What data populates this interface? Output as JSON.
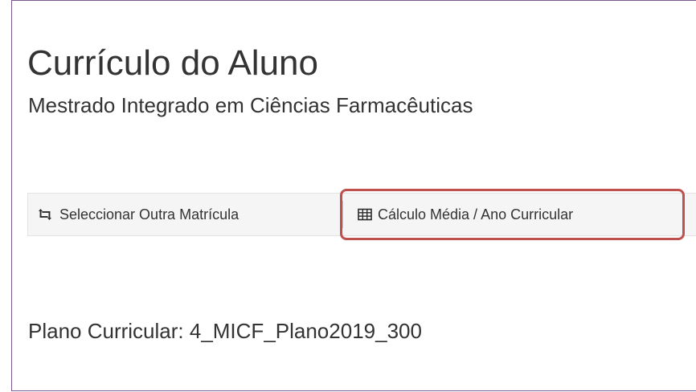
{
  "page": {
    "title": "Currículo do Aluno",
    "subtitle": "Mestrado Integrado em Ciências Farmacêuticas"
  },
  "toolbar": {
    "select_other_label": "Seleccionar Outra Matrícula",
    "select_other_icon": "retweet-icon",
    "calc_average_label": "Cálculo Média / Ano Curricular",
    "calc_average_icon": "table-icon"
  },
  "highlight": {
    "color": "#c0504d"
  },
  "plan": {
    "label": "Plano Curricular: 4_MICF_Plano2019_300"
  }
}
